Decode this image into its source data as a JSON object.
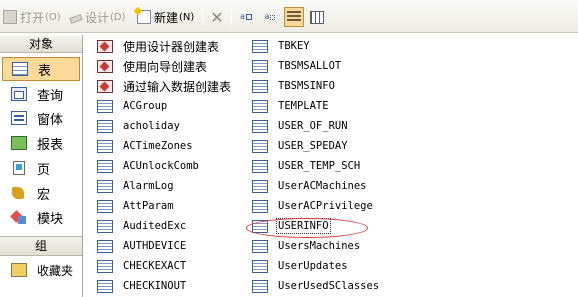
{
  "toolbar": {
    "open_label": "打开",
    "open_key": "(O)",
    "design_label": "设计",
    "design_key": "(D)",
    "new_label": "新建",
    "new_key": "(N)",
    "large_icons_tip": "a",
    "small_icons_tip": "a"
  },
  "nav": {
    "header": "对象",
    "items": [
      {
        "label": "表",
        "icon": "table-icon",
        "selected": true
      },
      {
        "label": "查询",
        "icon": "query-icon"
      },
      {
        "label": "窗体",
        "icon": "form-icon"
      },
      {
        "label": "报表",
        "icon": "report-icon"
      },
      {
        "label": "页",
        "icon": "page-icon"
      },
      {
        "label": "宏",
        "icon": "macro-icon"
      },
      {
        "label": "模块",
        "icon": "module-icon"
      }
    ],
    "group_header": "组",
    "favorites_label": "收藏夹"
  },
  "objects": {
    "column1": [
      {
        "label": "使用设计器创建表",
        "kind": "wizard"
      },
      {
        "label": "使用向导创建表",
        "kind": "wizard"
      },
      {
        "label": "通过输入数据创建表",
        "kind": "wizard"
      },
      {
        "label": "ACGroup",
        "kind": "table"
      },
      {
        "label": "acholiday",
        "kind": "table"
      },
      {
        "label": "ACTimeZones",
        "kind": "table"
      },
      {
        "label": "ACUnlockComb",
        "kind": "table"
      },
      {
        "label": "AlarmLog",
        "kind": "table"
      },
      {
        "label": "AttParam",
        "kind": "table"
      },
      {
        "label": "AuditedExc",
        "kind": "table"
      },
      {
        "label": "AUTHDEVICE",
        "kind": "table"
      },
      {
        "label": "CHECKEXACT",
        "kind": "table"
      },
      {
        "label": "CHECKINOUT",
        "kind": "table"
      }
    ],
    "column2": [
      {
        "label": "TBKEY",
        "kind": "table"
      },
      {
        "label": "TBSMSALLOT",
        "kind": "table"
      },
      {
        "label": "TBSMSINFO",
        "kind": "table"
      },
      {
        "label": "TEMPLATE",
        "kind": "table"
      },
      {
        "label": "USER_OF_RUN",
        "kind": "table"
      },
      {
        "label": "USER_SPEDAY",
        "kind": "table"
      },
      {
        "label": "USER_TEMP_SCH",
        "kind": "table"
      },
      {
        "label": "UserACMachines",
        "kind": "table"
      },
      {
        "label": "UserACPrivilege",
        "kind": "table"
      },
      {
        "label": "USERINFO",
        "kind": "table",
        "highlighted": true
      },
      {
        "label": "UsersMachines",
        "kind": "table"
      },
      {
        "label": "UserUpdates",
        "kind": "table"
      },
      {
        "label": "UserUsedSClasses",
        "kind": "table"
      }
    ]
  },
  "colors": {
    "selection_bg": "#fbd998",
    "selection_border": "#c08a36",
    "annotation_circle": "#d93a3a"
  }
}
